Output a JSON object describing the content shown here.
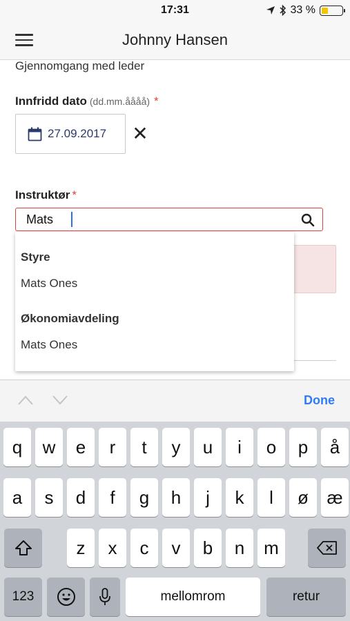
{
  "status_bar": {
    "time": "17:31",
    "battery_text": "33 %",
    "battery_level": 0.33
  },
  "nav": {
    "title": "Johnny Hansen",
    "menu_icon": "hamburger-menu-icon"
  },
  "form": {
    "review_text": "Gjennomgang med leder",
    "date_label": "Innfridd dato",
    "date_hint": "(dd.mm.åååå)",
    "required_mark": "*",
    "date_value": "27.09.2017",
    "clear_glyph": "✕",
    "instructor_label": "Instruktør",
    "instructor_required": "*",
    "instructor_value": "Mats"
  },
  "dropdown": {
    "groups": [
      {
        "name": "Styre",
        "items": [
          "Mats Ones"
        ]
      },
      {
        "name": "Økonomiavdeling",
        "items": [
          "Mats Ones"
        ]
      }
    ]
  },
  "accessory": {
    "done_label": "Done"
  },
  "keyboard": {
    "row1": [
      "q",
      "w",
      "e",
      "r",
      "t",
      "y",
      "u",
      "i",
      "o",
      "p",
      "å"
    ],
    "row2": [
      "a",
      "s",
      "d",
      "f",
      "g",
      "h",
      "j",
      "k",
      "l",
      "ø",
      "æ"
    ],
    "row3": [
      "z",
      "x",
      "c",
      "v",
      "b",
      "n",
      "m"
    ],
    "numbers_label": "123",
    "space_label": "mellomrom",
    "return_label": "retur"
  },
  "colors": {
    "accent": "#2f7cf6",
    "error": "#d9443a",
    "date_text": "#2b3a6b",
    "battery": "#f5c400"
  }
}
